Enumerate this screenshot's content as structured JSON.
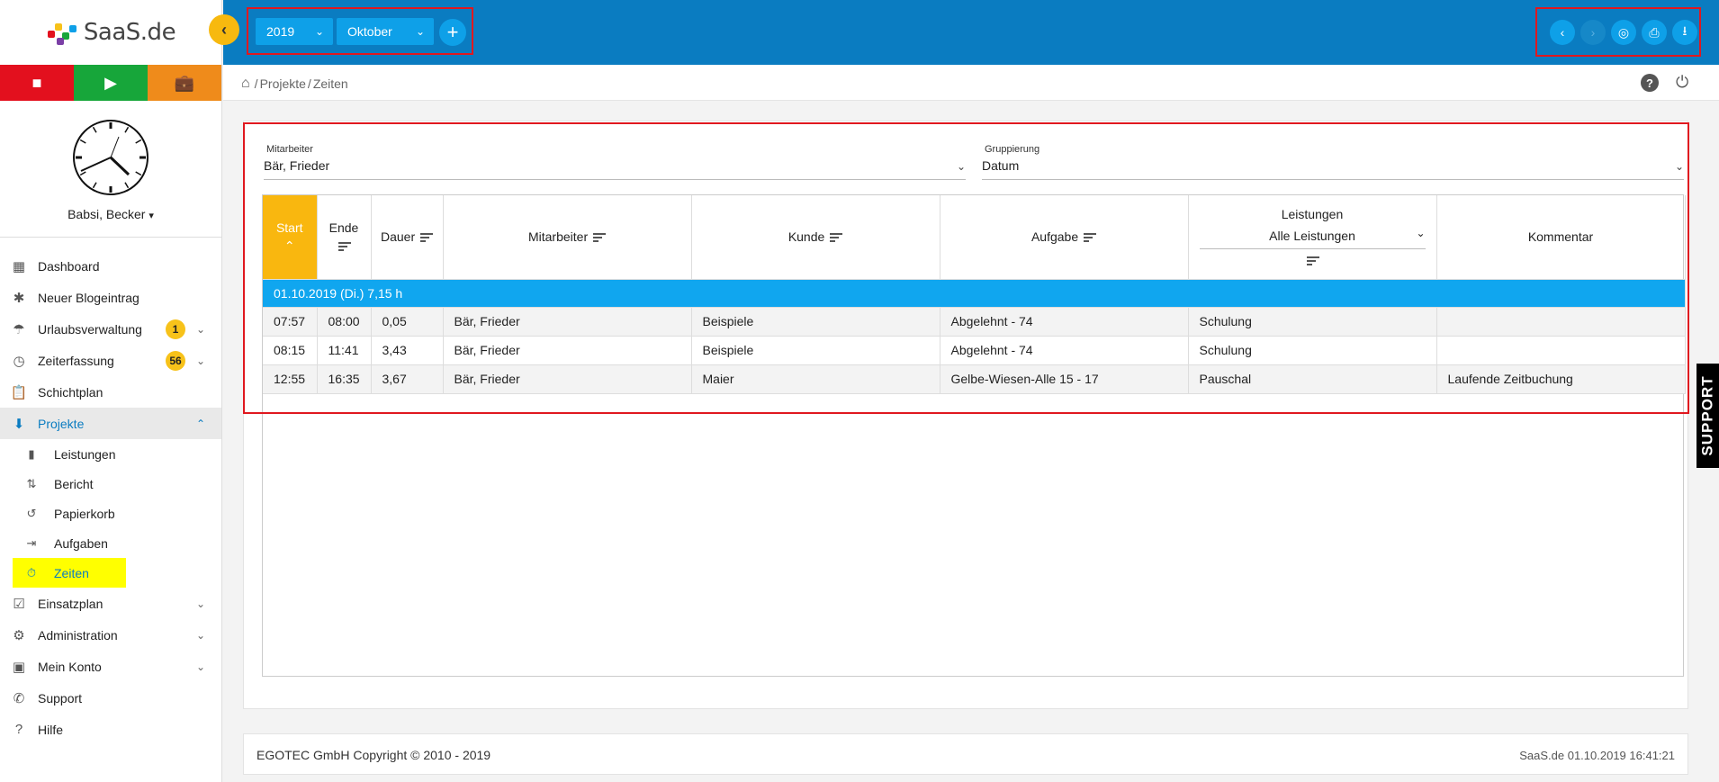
{
  "app": {
    "logo_text": "SaaS.de",
    "user_name": "Babsi, Becker"
  },
  "sidebar": {
    "items": [
      {
        "label": "Dashboard",
        "icon": "dashboard-icon"
      },
      {
        "label": "Neuer Blogeintrag",
        "icon": "blog-icon"
      },
      {
        "label": "Urlaubsverwaltung",
        "icon": "beach-icon",
        "badge": "1"
      },
      {
        "label": "Zeiterfassung",
        "icon": "clock-icon",
        "badge": "56"
      },
      {
        "label": "Schichtplan",
        "icon": "clipboard-icon"
      },
      {
        "label": "Projekte",
        "icon": "projects-icon"
      },
      {
        "label": "Einsatzplan",
        "icon": "clipboard-check-icon"
      },
      {
        "label": "Administration",
        "icon": "gear-icon"
      },
      {
        "label": "Mein Konto",
        "icon": "account-icon"
      },
      {
        "label": "Support",
        "icon": "phone-icon"
      },
      {
        "label": "Hilfe",
        "icon": "help-icon"
      }
    ],
    "sub_items": [
      {
        "label": "Leistungen"
      },
      {
        "label": "Bericht"
      },
      {
        "label": "Papierkorb"
      },
      {
        "label": "Aufgaben"
      },
      {
        "label": "Zeiten"
      }
    ]
  },
  "toolbar": {
    "year": "2019",
    "month": "Oktober"
  },
  "breadcrumb": {
    "path1": "Projekte",
    "path2": "Zeiten",
    "sep": "/"
  },
  "filters": {
    "employee_label": "Mitarbeiter",
    "employee_value": "Bär, Frieder",
    "grouping_label": "Gruppierung",
    "grouping_value": "Datum"
  },
  "table": {
    "headers": {
      "start": "Start",
      "end": "Ende",
      "duration": "Dauer",
      "employee": "Mitarbeiter",
      "customer": "Kunde",
      "task": "Aufgabe",
      "services": "Leistungen",
      "services_filter": "Alle Leistungen",
      "comment": "Kommentar"
    },
    "group_label": "01.10.2019 (Di.) 7,15 h",
    "rows": [
      {
        "start": "07:57",
        "end": "08:00",
        "duration": "0,05",
        "employee": "Bär, Frieder",
        "customer": "Beispiele",
        "task": "Abgelehnt - 74",
        "service": "Schulung",
        "comment": ""
      },
      {
        "start": "08:15",
        "end": "11:41",
        "duration": "3,43",
        "employee": "Bär, Frieder",
        "customer": "Beispiele",
        "task": "Abgelehnt - 74",
        "service": "Schulung",
        "comment": ""
      },
      {
        "start": "12:55",
        "end": "16:35",
        "duration": "3,67",
        "employee": "Bär, Frieder",
        "customer": "Maier",
        "task": "Gelbe-Wiesen-Alle 15 - 17",
        "service": "Pauschal",
        "comment": "Laufende Zeitbuchung"
      }
    ]
  },
  "support_tab": "SUPPORT",
  "footer": {
    "copyright": "EGOTEC GmbH Copyright © 2010 - 2019",
    "right": "SaaS.de  01.10.2019 16:41:21"
  },
  "colors": {
    "primary": "#0a7cc1",
    "accent": "#0ea0e8",
    "highlight": "#f9b70f",
    "group": "#10a6ef"
  }
}
